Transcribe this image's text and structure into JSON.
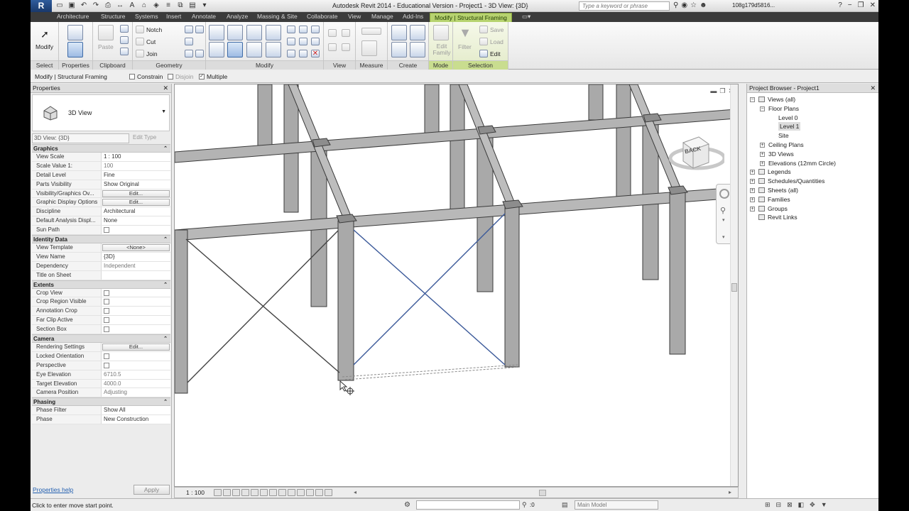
{
  "titlebar": {
    "app_button": "R",
    "title": "Autodesk Revit 2014 - Educational Version -     Project1 - 3D View: {3D}",
    "search_placeholder": "Type a keyword or phrase",
    "user": "108g179d5816..."
  },
  "tabs": [
    {
      "label": "Architecture"
    },
    {
      "label": "Structure"
    },
    {
      "label": "Systems"
    },
    {
      "label": "Insert"
    },
    {
      "label": "Annotate"
    },
    {
      "label": "Analyze"
    },
    {
      "label": "Massing & Site"
    },
    {
      "label": "Collaborate"
    },
    {
      "label": "View"
    },
    {
      "label": "Manage"
    },
    {
      "label": "Add-Ins"
    },
    {
      "label": "Modify | Structural Framing"
    }
  ],
  "ribbon": {
    "modify_label": "Modify",
    "panels": {
      "select": "Select",
      "properties": "Properties",
      "clipboard": "Clipboard",
      "geometry": "Geometry",
      "modify": "Modify",
      "view": "View",
      "measure": "Measure",
      "create": "Create",
      "mode": "Mode",
      "selection": "Selection"
    },
    "clipboard_items": {
      "paste": "Paste"
    },
    "geometry_items": {
      "notch": "Notch",
      "cut": "Cut",
      "join": "Join"
    },
    "mode_items": {
      "edit_family": "Edit Family"
    },
    "selection_items": {
      "filter": "Filter",
      "save": "Save",
      "load": "Load",
      "edit": "Edit"
    }
  },
  "options_bar": {
    "context": "Modify | Structural Framing",
    "constrain": "Constrain",
    "disjoin": "Disjoin",
    "multiple": "Multiple",
    "multiple_checked": "✓"
  },
  "properties": {
    "title": "Properties",
    "type_name": "3D View",
    "filter": "3D View: {3D}",
    "edit_type": "Edit Type",
    "groups": [
      {
        "name": "Graphics",
        "rows": [
          {
            "name": "View Scale",
            "value": "1 : 100"
          },
          {
            "name": "Scale Value    1:",
            "value": "100",
            "gray": true
          },
          {
            "name": "Detail Level",
            "value": "Fine"
          },
          {
            "name": "Parts Visibility",
            "value": "Show Original"
          },
          {
            "name": "Visibility/Graphics Ov...",
            "value": "Edit...",
            "button": true
          },
          {
            "name": "Graphic Display Options",
            "value": "Edit...",
            "button": true
          },
          {
            "name": "Discipline",
            "value": "Architectural"
          },
          {
            "name": "Default Analysis Displ...",
            "value": "None"
          },
          {
            "name": "Sun Path",
            "value": "",
            "check": true
          }
        ]
      },
      {
        "name": "Identity Data",
        "rows": [
          {
            "name": "View Template",
            "value": "<None>",
            "button": true
          },
          {
            "name": "View Name",
            "value": "{3D}"
          },
          {
            "name": "Dependency",
            "value": "Independent",
            "gray": true
          },
          {
            "name": "Title on Sheet",
            "value": ""
          }
        ]
      },
      {
        "name": "Extents",
        "rows": [
          {
            "name": "Crop View",
            "value": "",
            "check": true
          },
          {
            "name": "Crop Region Visible",
            "value": "",
            "check": true
          },
          {
            "name": "Annotation Crop",
            "value": "",
            "check": true
          },
          {
            "name": "Far Clip Active",
            "value": "",
            "check": true
          },
          {
            "name": "Section Box",
            "value": "",
            "check": true
          }
        ]
      },
      {
        "name": "Camera",
        "rows": [
          {
            "name": "Rendering Settings",
            "value": "Edit...",
            "button": true
          },
          {
            "name": "Locked Orientation",
            "value": "",
            "check": true
          },
          {
            "name": "Perspective",
            "value": "",
            "check": true
          },
          {
            "name": "Eye Elevation",
            "value": "6710.5",
            "gray": true
          },
          {
            "name": "Target Elevation",
            "value": "4000.0",
            "gray": true
          },
          {
            "name": "Camera Position",
            "value": "Adjusting",
            "gray": true
          }
        ]
      },
      {
        "name": "Phasing",
        "rows": [
          {
            "name": "Phase Filter",
            "value": "Show All"
          },
          {
            "name": "Phase",
            "value": "New Construction"
          }
        ]
      }
    ],
    "help_link": "Properties help",
    "apply": "Apply"
  },
  "viewport": {
    "viewcube_face": "BACK",
    "scale": "1 : 100"
  },
  "browser": {
    "title": "Project Browser - Project1",
    "items": [
      {
        "label": "Views (all)",
        "level": 0,
        "expander": "−",
        "icon": true
      },
      {
        "label": "Floor Plans",
        "level": 1,
        "expander": "−"
      },
      {
        "label": "Level 0",
        "level": 2
      },
      {
        "label": "Level 1",
        "level": 2,
        "selected": true
      },
      {
        "label": "Site",
        "level": 2
      },
      {
        "label": "Ceiling Plans",
        "level": 1,
        "expander": "+"
      },
      {
        "label": "3D Views",
        "level": 1,
        "expander": "+"
      },
      {
        "label": "Elevations (12mm Circle)",
        "level": 1,
        "expander": "+"
      },
      {
        "label": "Legends",
        "level": 0,
        "expander": "+",
        "icon": true
      },
      {
        "label": "Schedules/Quantities",
        "level": 0,
        "expander": "+",
        "icon": true
      },
      {
        "label": "Sheets (all)",
        "level": 0,
        "expander": "+",
        "icon": true
      },
      {
        "label": "Families",
        "level": 0,
        "expander": "+",
        "icon": true
      },
      {
        "label": "Groups",
        "level": 0,
        "expander": "+",
        "icon": true
      },
      {
        "label": "Revit Links",
        "level": 0,
        "icon": true
      }
    ]
  },
  "statusbar": {
    "message": "Click to enter move start point.",
    "count": ":0",
    "model": "Main Model"
  },
  "colors": {
    "accent_tab": "#b7d36f",
    "bracing_blue": "#3c5a9a"
  }
}
